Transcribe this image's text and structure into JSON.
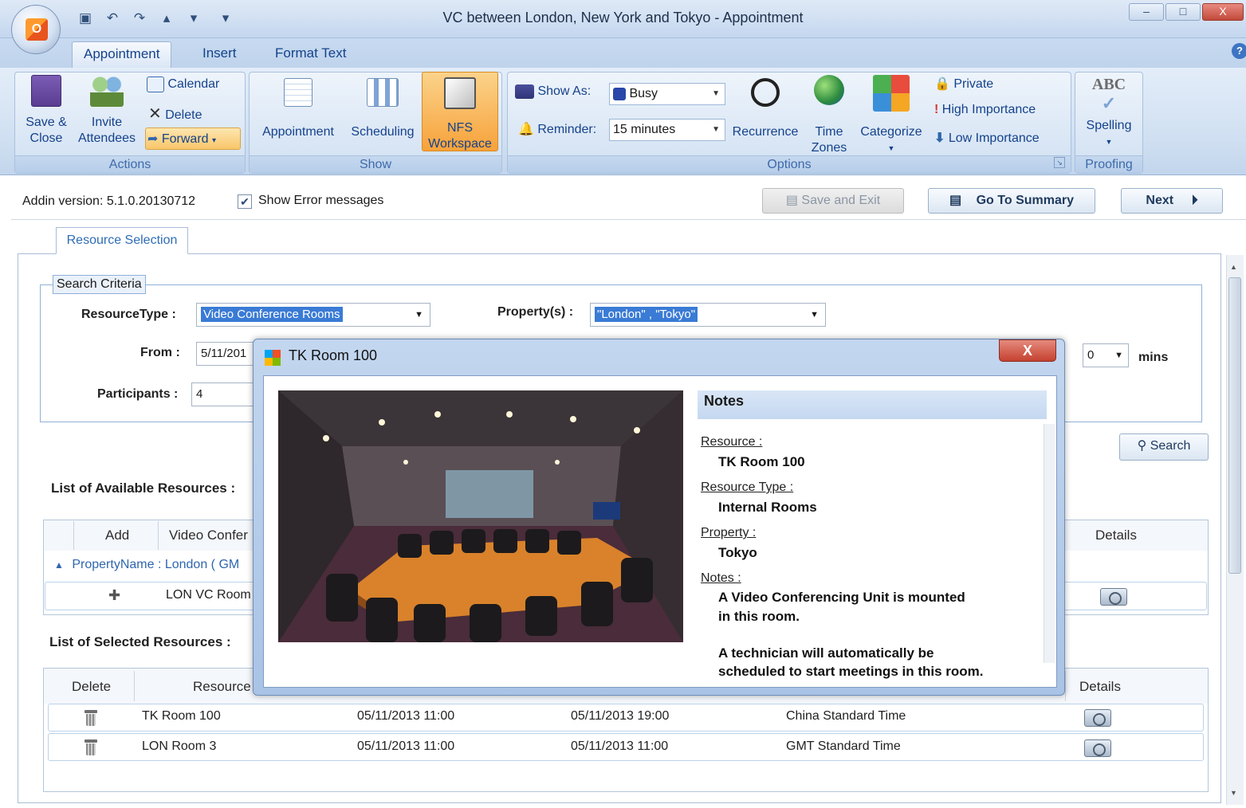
{
  "window": {
    "title": "VC between London, New York and Tokyo - Appointment",
    "controls": {
      "minimize": "–",
      "maximize": "□",
      "close": "X"
    }
  },
  "ribbon": {
    "tabs": [
      "Appointment",
      "Insert",
      "Format Text"
    ],
    "actions": {
      "save_close": [
        "Save &",
        "Close"
      ],
      "invite": [
        "Invite",
        "Attendees"
      ],
      "calendar": "Calendar",
      "delete": "Delete",
      "forward": "Forward",
      "group_label": "Actions"
    },
    "show": {
      "appointment": "Appointment",
      "scheduling": "Scheduling",
      "nfs": [
        "NFS",
        "Workspace"
      ],
      "group_label": "Show"
    },
    "options": {
      "show_as_label": "Show As:",
      "show_as_value": "Busy",
      "reminder_label": "Reminder:",
      "reminder_value": "15 minutes",
      "recurrence": "Recurrence",
      "time_zones": [
        "Time",
        "Zones"
      ],
      "categorize": "Categorize",
      "private": "Private",
      "high_importance": "High Importance",
      "low_importance": "Low Importance",
      "group_label": "Options"
    },
    "proofing": {
      "spelling": "Spelling",
      "abc": "ABC",
      "group_label": "Proofing"
    }
  },
  "toolbar": {
    "addin_version": "Addin version: 5.1.0.20130712",
    "show_errors": "Show Error messages",
    "save_exit": "Save and Exit",
    "go_summary": "Go To Summary",
    "next": "Next"
  },
  "resource_tab": "Resource Selection",
  "search": {
    "legend": "Search Criteria",
    "resource_type_label": "ResourceType :",
    "resource_type_value": "Video Conference Rooms",
    "property_label": "Property(s) :",
    "property_value": "\"London\" , \"Tokyo\"",
    "from_label": "From :",
    "from_value": "5/11/201",
    "participants_label": "Participants :",
    "participants_value": "4",
    "mins_value": "0",
    "mins_label": "mins",
    "search_button": "Search"
  },
  "available": {
    "title": "List of Available Resources :",
    "columns": [
      "Add",
      "Video Confer",
      "Details"
    ],
    "group_row": "PropertyName : London ( GM",
    "row": {
      "name": "LON VC Room"
    }
  },
  "selected": {
    "title": "List of Selected Resources :",
    "columns": [
      "Delete",
      "Resource",
      "Details"
    ],
    "rows": [
      {
        "name": "TK Room 100",
        "start": "05/11/2013 11:00",
        "end": "05/11/2013 19:00",
        "tz": "China Standard Time"
      },
      {
        "name": "LON Room 3",
        "start": "05/11/2013 11:00",
        "end": "05/11/2013 11:00",
        "tz": "GMT Standard Time"
      }
    ]
  },
  "modal": {
    "title": "TK Room 100",
    "close": "X",
    "notes_header": "Notes",
    "resource_label": "Resource :",
    "resource_value": "TK Room 100",
    "type_label": "Resource Type :",
    "type_value": "Internal Rooms",
    "property_label": "Property :",
    "property_value": "Tokyo",
    "notes_label": "Notes :",
    "notes_line1": "A Video Conferencing Unit is mounted",
    "notes_line2": "in this room.",
    "notes_line3": "A technician will automatically be",
    "notes_line4": "scheduled to start meetings in this room."
  }
}
